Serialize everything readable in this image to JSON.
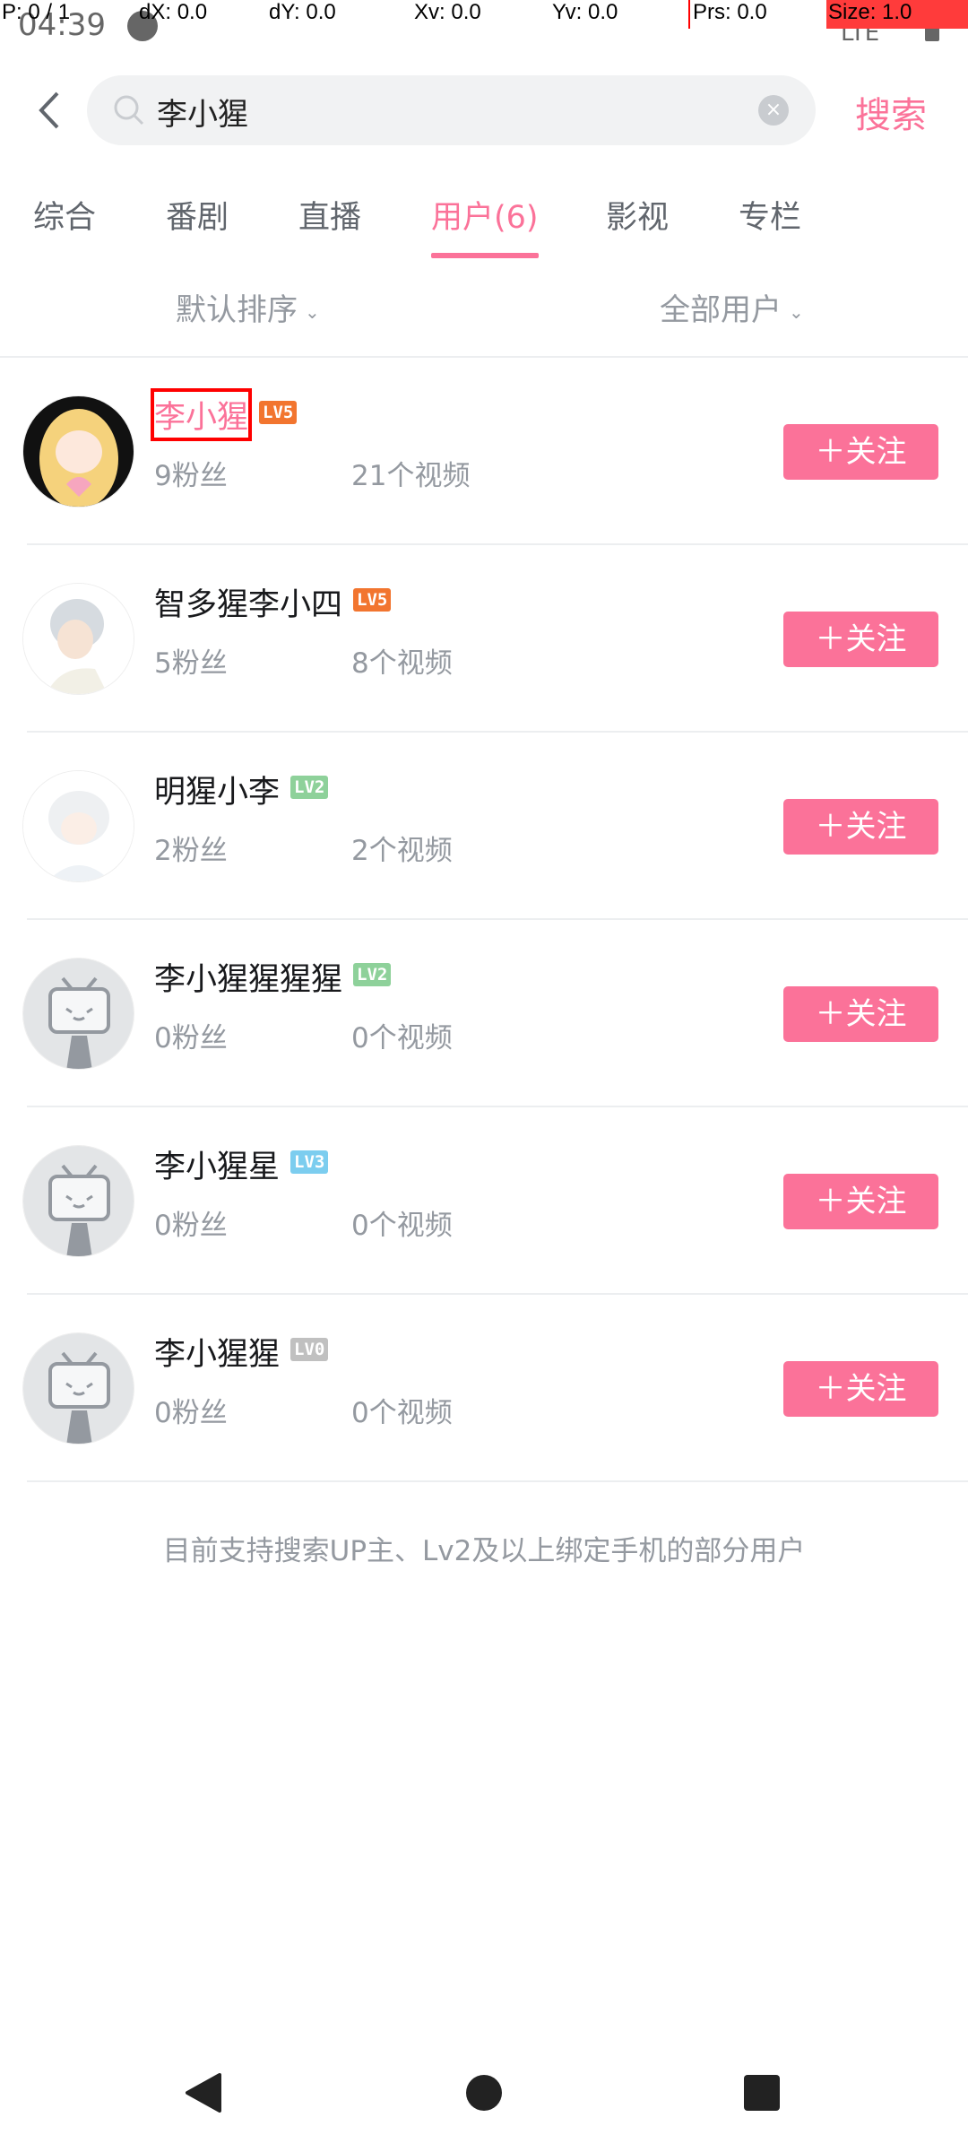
{
  "status_bar": {
    "time": "04:39",
    "network": "LTE"
  },
  "debug_overlay": [
    "P: 0 / 1",
    "dX: 0.0",
    "dY: 0.0",
    "Xv: 0.0",
    "Yv: 0.0",
    "Prs: 0.0",
    "Size: 1.0"
  ],
  "search": {
    "query": "李小猩",
    "submit_label": "搜索"
  },
  "tabs": [
    {
      "label": "综合"
    },
    {
      "label": "番剧"
    },
    {
      "label": "直播"
    },
    {
      "label": "用户(6)",
      "active": true
    },
    {
      "label": "影视"
    },
    {
      "label": "专栏"
    }
  ],
  "filters": {
    "sort": "默认排序",
    "user_type": "全部用户"
  },
  "users": [
    {
      "name": "李小猩",
      "level": "LV5",
      "level_color": "#f2752f",
      "fans": "9粉丝",
      "videos": "21个视频",
      "follow": "关注",
      "avatar": "anime-girl"
    },
    {
      "name": "智多猩李小四",
      "level": "LV5",
      "level_color": "#f2752f",
      "fans": "5粉丝",
      "videos": "8个视频",
      "follow": "关注",
      "avatar": "anime-boy"
    },
    {
      "name": "明猩小李",
      "level": "LV2",
      "level_color": "#8ed19a",
      "fans": "2粉丝",
      "videos": "2个视频",
      "follow": "关注",
      "avatar": "anime-white"
    },
    {
      "name": "李小猩猩猩猩",
      "level": "LV2",
      "level_color": "#8ed19a",
      "fans": "0粉丝",
      "videos": "0个视频",
      "follow": "关注",
      "avatar": "default"
    },
    {
      "name": "李小猩星",
      "level": "LV3",
      "level_color": "#7ccdef",
      "fans": "0粉丝",
      "videos": "0个视频",
      "follow": "关注",
      "avatar": "default"
    },
    {
      "name": "李小猩猩",
      "level": "LV0",
      "level_color": "#c0c0c0",
      "fans": "0粉丝",
      "videos": "0个视频",
      "follow": "关注",
      "avatar": "default"
    }
  ],
  "footer_note": "目前支持搜索UP主、Lv2及以上绑定手机的部分用户",
  "colors": {
    "accent": "#fb7299"
  }
}
